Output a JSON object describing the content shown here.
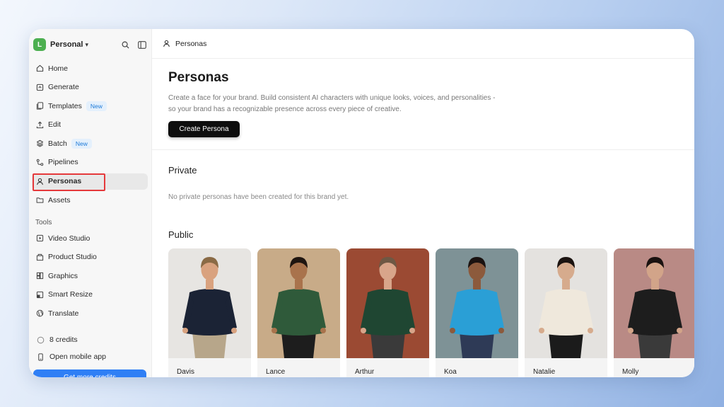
{
  "sidebar": {
    "workspace": {
      "badge": "L",
      "name": "Personal",
      "chevron": "▾"
    },
    "nav": [
      {
        "label": "Home",
        "icon": "home-icon"
      },
      {
        "label": "Generate",
        "icon": "generate-icon"
      },
      {
        "label": "Templates",
        "icon": "templates-icon",
        "badge": "New"
      },
      {
        "label": "Edit",
        "icon": "edit-icon"
      },
      {
        "label": "Batch",
        "icon": "batch-icon",
        "badge": "New"
      },
      {
        "label": "Pipelines",
        "icon": "pipelines-icon"
      },
      {
        "label": "Personas",
        "icon": "person-icon",
        "active": true
      },
      {
        "label": "Assets",
        "icon": "folder-icon"
      }
    ],
    "tools_label": "Tools",
    "tools": [
      {
        "label": "Video Studio",
        "icon": "video-icon"
      },
      {
        "label": "Product Studio",
        "icon": "product-icon"
      },
      {
        "label": "Graphics",
        "icon": "graphics-icon"
      },
      {
        "label": "Smart Resize",
        "icon": "resize-icon"
      },
      {
        "label": "Translate",
        "icon": "globe-icon"
      }
    ],
    "credits": "8 credits",
    "mobile": "Open mobile app",
    "cta": "Get more credits"
  },
  "topbar": {
    "breadcrumb": "Personas"
  },
  "main": {
    "title": "Personas",
    "description": "Create a face for your brand. Build consistent AI characters with unique looks, voices, and personalities - so your brand has a recognizable presence across every piece of creative.",
    "create_button": "Create Persona",
    "private_heading": "Private",
    "private_empty": "No private personas have been created for this brand yet.",
    "public_heading": "Public",
    "personas": [
      {
        "name": "Davis",
        "bg": "#e7e5e2",
        "skin": "#d9a27f",
        "hair": "#8a6a45",
        "top": "#1b2335",
        "bottom": "#b7a68a"
      },
      {
        "name": "Lance",
        "bg": "#c8ab88",
        "skin": "#a9734c",
        "hair": "#1f1510",
        "top": "#2f5a3a",
        "bottom": "#1d1d1d"
      },
      {
        "name": "Arthur",
        "bg": "#9b4a33",
        "skin": "#d8a58a",
        "hair": "#6e5844",
        "top": "#1f4632",
        "bottom": "#3a3a3a"
      },
      {
        "name": "Koa",
        "bg": "#7e9296",
        "skin": "#8c5a3c",
        "hair": "#1a1210",
        "top": "#2a9fd6",
        "bottom": "#2e3a56"
      },
      {
        "name": "Natalie",
        "bg": "#e4e2df",
        "skin": "#d6ab8d",
        "hair": "#1b1310",
        "top": "#efe8dc",
        "bottom": "#1b1b1b"
      },
      {
        "name": "Molly",
        "bg": "#b98a85",
        "skin": "#d2a489",
        "hair": "#1a1210",
        "top": "#1d1d1d",
        "bottom": "#3a3a3a"
      }
    ]
  },
  "colors": {
    "accent": "#2f7ff5",
    "workspace_badge": "#4caf50",
    "highlight": "#e5393b",
    "new_badge_text": "#1e7ad8"
  }
}
